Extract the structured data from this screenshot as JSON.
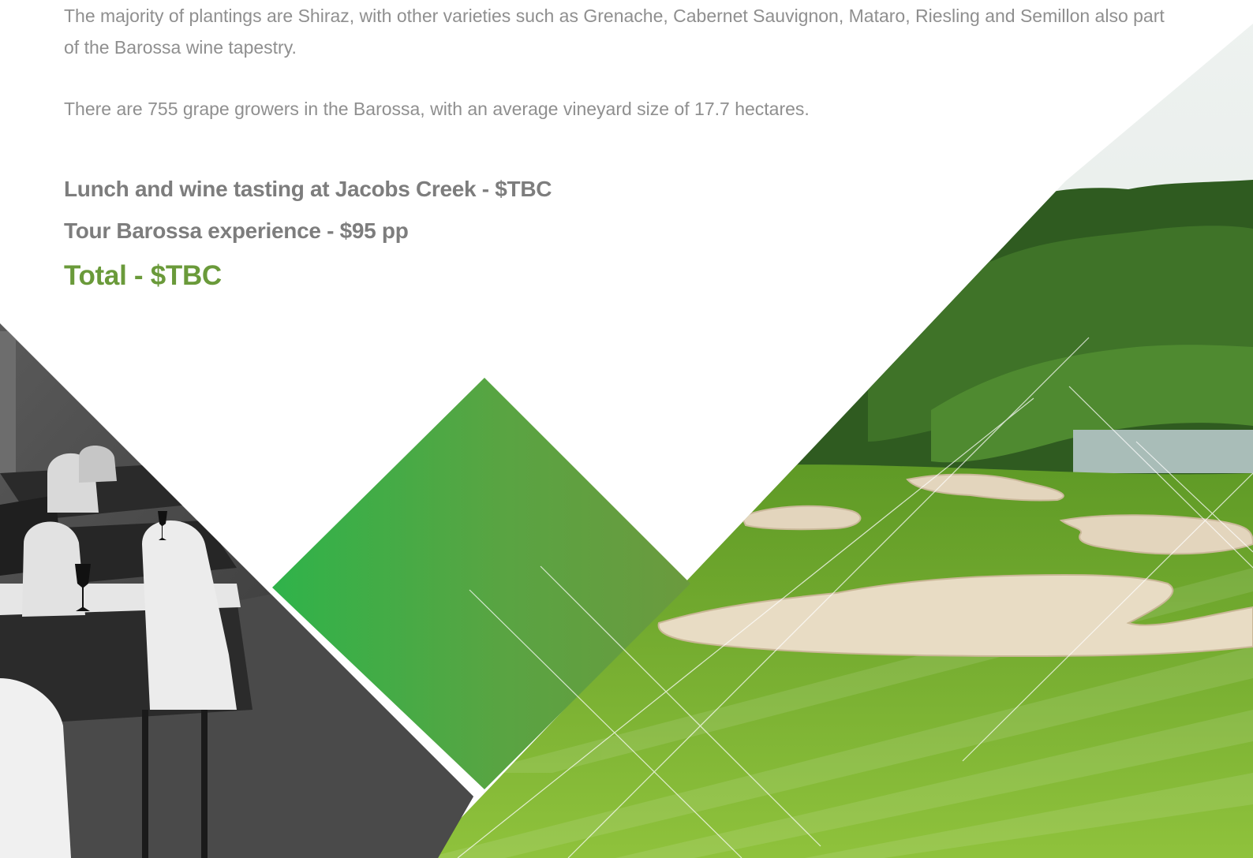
{
  "intro": {
    "paragraph_1": "The majority of plantings are Shiraz, with other varieties such as Grenache, Cabernet Sauvignon, Mataro, Riesling and Semillon also part of the Barossa wine tapestry.",
    "paragraph_2": "There are 755 grape growers in the Barossa, with an average vineyard size of 17.7 hectares."
  },
  "pricing": {
    "items": [
      "Lunch and wine tasting at Jacobs Creek - $TBC",
      "Tour Barossa experience - $95 pp"
    ],
    "total": "Total - $TBC"
  },
  "colors": {
    "body_text": "#8f8f8f",
    "item_text": "#7d7d7d",
    "total_text": "#6a9a3a",
    "accent_green_light": "#2fb34a",
    "accent_green_dark": "#6b9a3e"
  },
  "images": {
    "left": "conference-room-photo",
    "right": "golf-course-photo"
  }
}
